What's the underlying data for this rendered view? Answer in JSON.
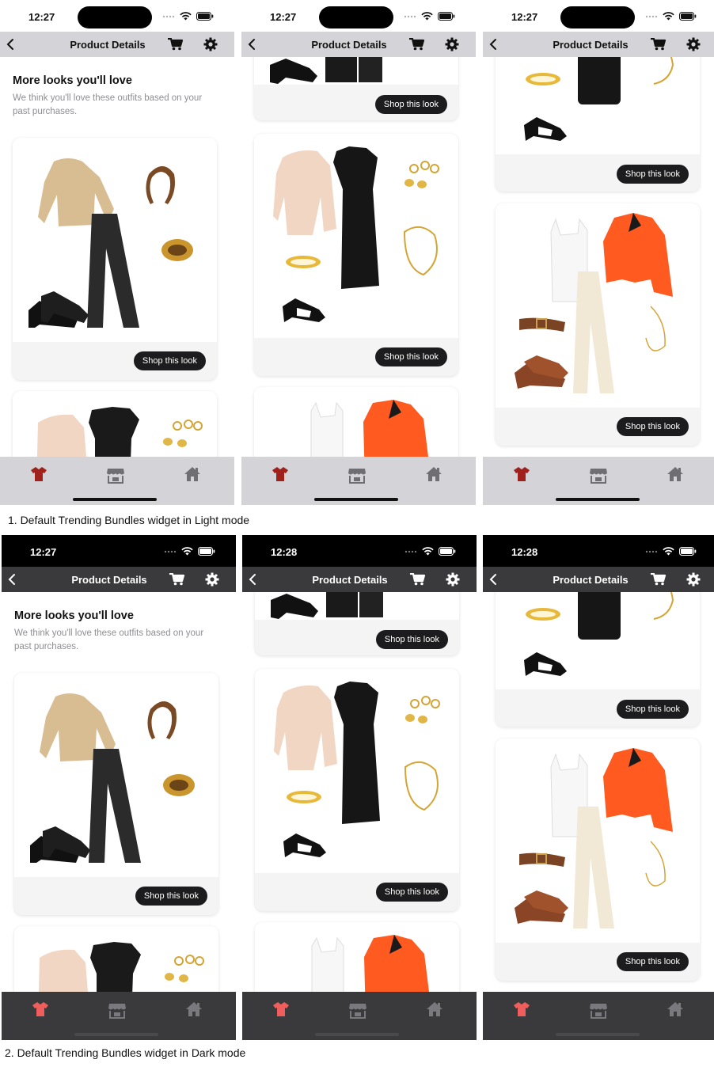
{
  "screens": {
    "light": {
      "status_times": [
        "12:27",
        "12:27",
        "12:27"
      ],
      "nav_titles": [
        "Product Details",
        "Product Details",
        "Product Details"
      ]
    },
    "dark": {
      "status_times": [
        "12:27",
        "12:28",
        "12:28"
      ],
      "nav_titles": [
        "Product Details",
        "Product Details",
        "Product Details"
      ]
    }
  },
  "section": {
    "title": "More looks you'll love",
    "subtitle": "We think you'll love these outfits based on your past purchases."
  },
  "card": {
    "button_label": "Shop this look"
  },
  "tabs": [
    {
      "icon": "shirt-icon",
      "active": true
    },
    {
      "icon": "store-icon",
      "active": false
    },
    {
      "icon": "home-icon",
      "active": false
    }
  ],
  "captions": {
    "light": "1. Default Trending Bundles widget in Light mode",
    "dark": "2. Default Trending Bundles widget in Dark mode"
  },
  "colors": {
    "light_bar": "#d4d4d8",
    "dark_bar": "#3a3a3c",
    "active_tab_light": "#a0201c",
    "active_tab_dark": "#ef5d5d",
    "button": "#1c1c1e"
  }
}
